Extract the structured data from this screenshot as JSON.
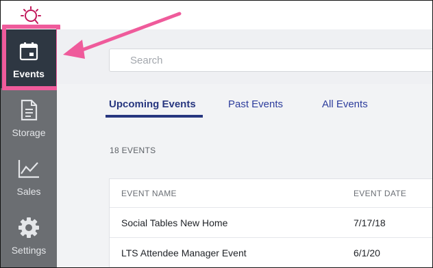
{
  "nav": {
    "items": [
      {
        "label": "Events",
        "icon": "calendar-icon",
        "active": true
      },
      {
        "label": "Storage",
        "icon": "document-icon",
        "active": false
      },
      {
        "label": "Sales",
        "icon": "line-chart-icon",
        "active": false
      },
      {
        "label": "Settings",
        "icon": "gear-icon",
        "active": false
      }
    ]
  },
  "search": {
    "placeholder": "Search"
  },
  "tabs": [
    {
      "label": "Upcoming Events",
      "active": true
    },
    {
      "label": "Past Events",
      "active": false
    },
    {
      "label": "All Events",
      "active": false
    }
  ],
  "events_count": "18 EVENTS",
  "table": {
    "columns": [
      "EVENT NAME",
      "EVENT DATE"
    ],
    "rows": [
      {
        "name": "Social Tables New Home",
        "date": "7/17/18"
      },
      {
        "name": "LTS Attendee Manager Event",
        "date": "6/1/20"
      }
    ]
  },
  "colors": {
    "brand_pink": "#ef5b9b",
    "sidebar": "#6b6e72",
    "sidebar_active": "#2e3742",
    "tab_blue": "#27367f"
  }
}
